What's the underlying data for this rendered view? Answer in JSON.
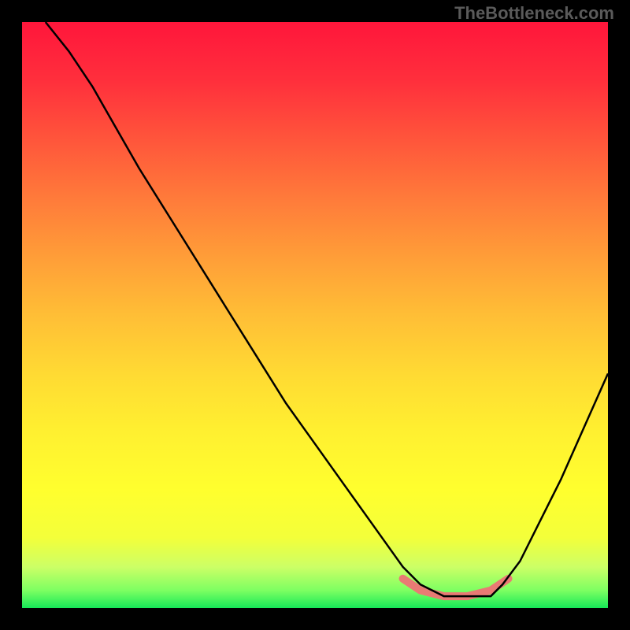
{
  "watermark": "TheBottleneck.com",
  "chart_data": {
    "type": "line",
    "title": "",
    "xlabel": "",
    "ylabel": "",
    "xlim": [
      0,
      100
    ],
    "ylim": [
      0,
      100
    ],
    "description": "Bottleneck percentage curve over a red-to-green vertical gradient background. The curve descends steeply from top-left, reaches a flat salmon-highlighted minimum region around x=68-82 near y=2, then rises again toward the right.",
    "gradient_stops": [
      {
        "offset": 0.0,
        "color": "#ff163b"
      },
      {
        "offset": 0.1,
        "color": "#ff2f3c"
      },
      {
        "offset": 0.2,
        "color": "#ff553b"
      },
      {
        "offset": 0.3,
        "color": "#ff7a3a"
      },
      {
        "offset": 0.4,
        "color": "#ff9d38"
      },
      {
        "offset": 0.5,
        "color": "#ffbe36"
      },
      {
        "offset": 0.6,
        "color": "#ffda33"
      },
      {
        "offset": 0.7,
        "color": "#fff030"
      },
      {
        "offset": 0.8,
        "color": "#ffff2e"
      },
      {
        "offset": 0.88,
        "color": "#f3ff3a"
      },
      {
        "offset": 0.93,
        "color": "#ccff66"
      },
      {
        "offset": 0.97,
        "color": "#7dff62"
      },
      {
        "offset": 1.0,
        "color": "#17e858"
      }
    ],
    "series": [
      {
        "name": "bottleneck-curve",
        "color": "#000000",
        "x": [
          4,
          8,
          12,
          16,
          20,
          25,
          30,
          35,
          40,
          45,
          50,
          55,
          60,
          65,
          68,
          72,
          76,
          80,
          82,
          85,
          88,
          92,
          96,
          100
        ],
        "y": [
          100,
          95,
          89,
          82,
          75,
          67,
          59,
          51,
          43,
          35,
          28,
          21,
          14,
          7,
          4,
          2,
          2,
          2,
          4,
          8,
          14,
          22,
          31,
          40
        ]
      }
    ],
    "highlight_region": {
      "name": "minimum-plateau",
      "color": "#e97a74",
      "x": [
        65,
        68,
        72,
        76,
        80,
        83
      ],
      "y": [
        5,
        3,
        2,
        2,
        3,
        5
      ]
    }
  }
}
